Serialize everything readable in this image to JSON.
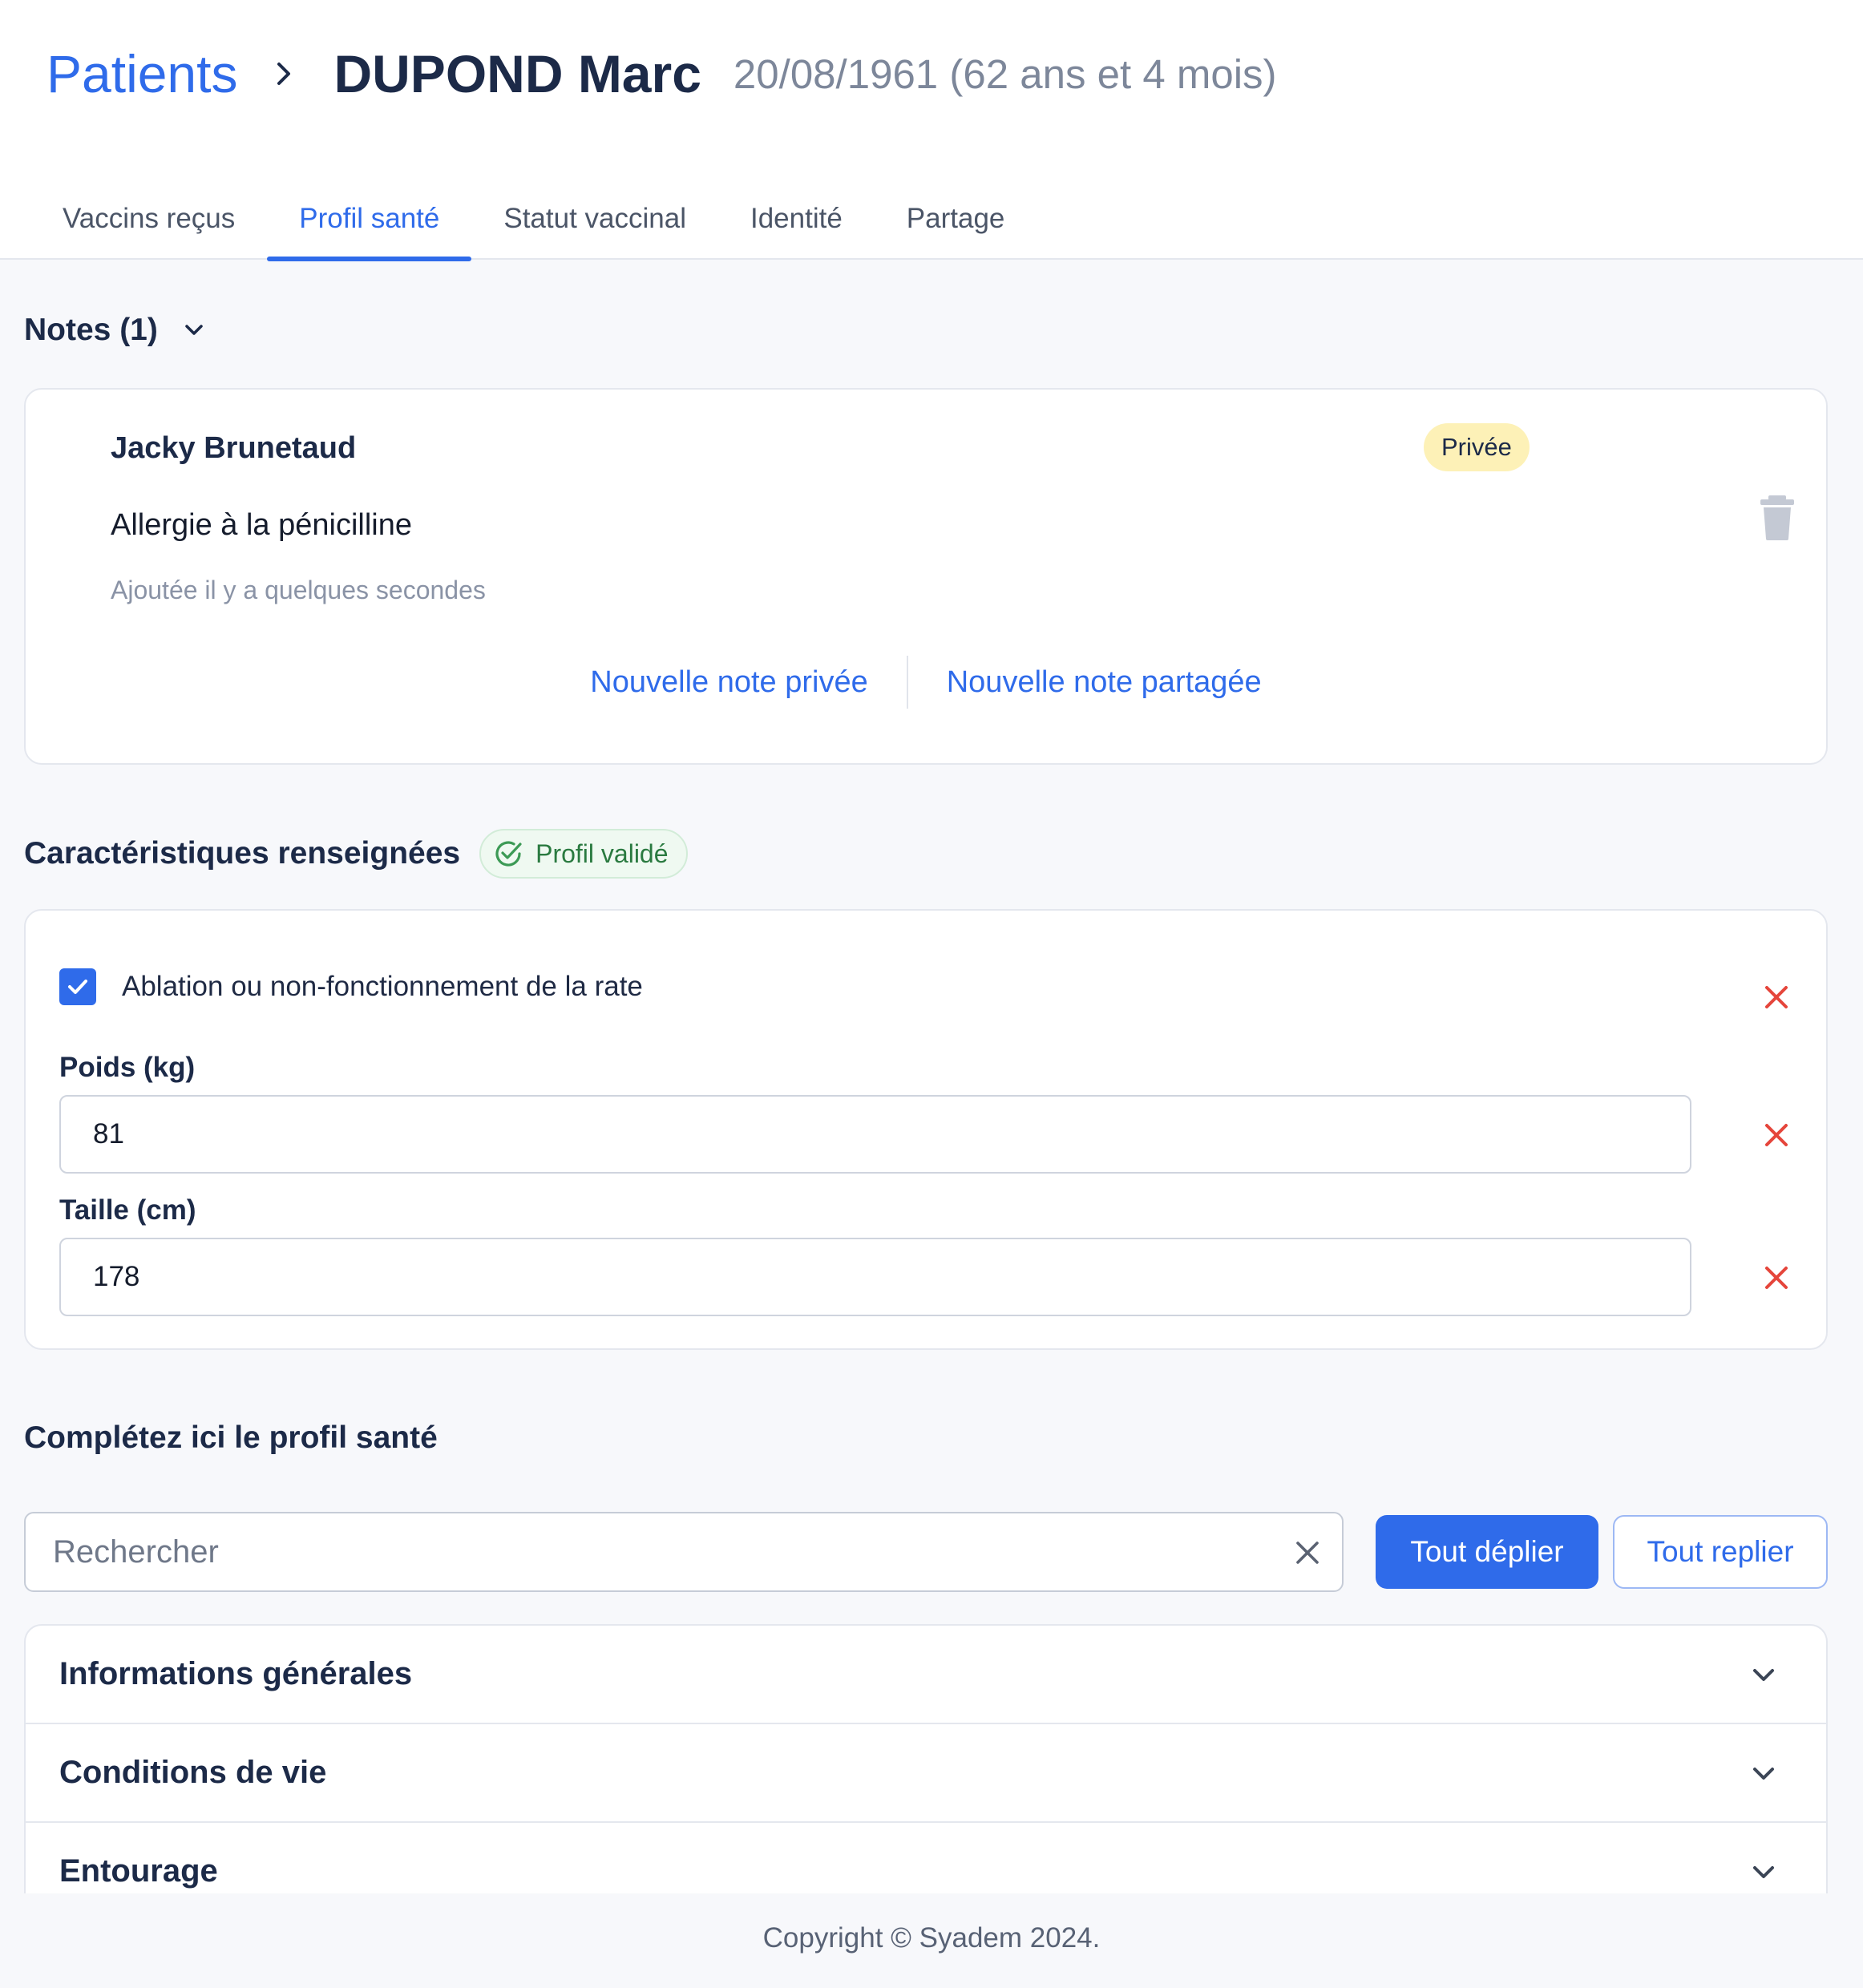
{
  "header": {
    "breadcrumb_root": "Patients",
    "patient_name": "DUPOND Marc",
    "patient_dob": "20/08/1961 (62 ans et 4 mois)"
  },
  "tabs": [
    {
      "label": "Vaccins reçus",
      "active": false
    },
    {
      "label": "Profil santé",
      "active": true
    },
    {
      "label": "Statut vaccinal",
      "active": false
    },
    {
      "label": "Identité",
      "active": false
    },
    {
      "label": "Partage",
      "active": false
    }
  ],
  "notes": {
    "title": "Notes (1)",
    "items": [
      {
        "author": "Jacky Brunetaud",
        "visibility": "Privée",
        "text": "Allergie à la pénicilline",
        "added": "Ajoutée il y a quelques secondes"
      }
    ],
    "new_private": "Nouvelle note privée",
    "new_shared": "Nouvelle note partagée"
  },
  "characteristics": {
    "title": "Caractéristiques renseignées",
    "badge": "Profil validé",
    "checkbox_label": "Ablation ou non-fonctionnement de la rate",
    "checkbox_checked": true,
    "weight_label": "Poids (kg)",
    "weight_value": "81",
    "height_label": "Taille (cm)",
    "height_value": "178"
  },
  "complete": {
    "title": "Complétez ici le profil santé",
    "search_placeholder": "Rechercher",
    "expand_all": "Tout déplier",
    "collapse_all": "Tout replier",
    "sections": [
      "Informations générales",
      "Conditions de vie",
      "Entourage"
    ]
  },
  "footer": {
    "copyright": "Copyright © Syadem 2024."
  },
  "icons": {
    "breadcrumb_separator": "chevron-right-icon",
    "notes_toggle": "chevron-down-icon",
    "delete_note": "trash-icon",
    "validated": "check-circle-icon",
    "remove": "close-icon",
    "clear_search": "close-icon",
    "section_toggle": "chevron-down-icon"
  },
  "colors": {
    "primary": "#2f6bea",
    "danger": "#e5453b",
    "private_badge_bg": "#fdf1b7",
    "valid_badge_text": "#2a7a40",
    "page_bg": "#f7f8fb"
  }
}
